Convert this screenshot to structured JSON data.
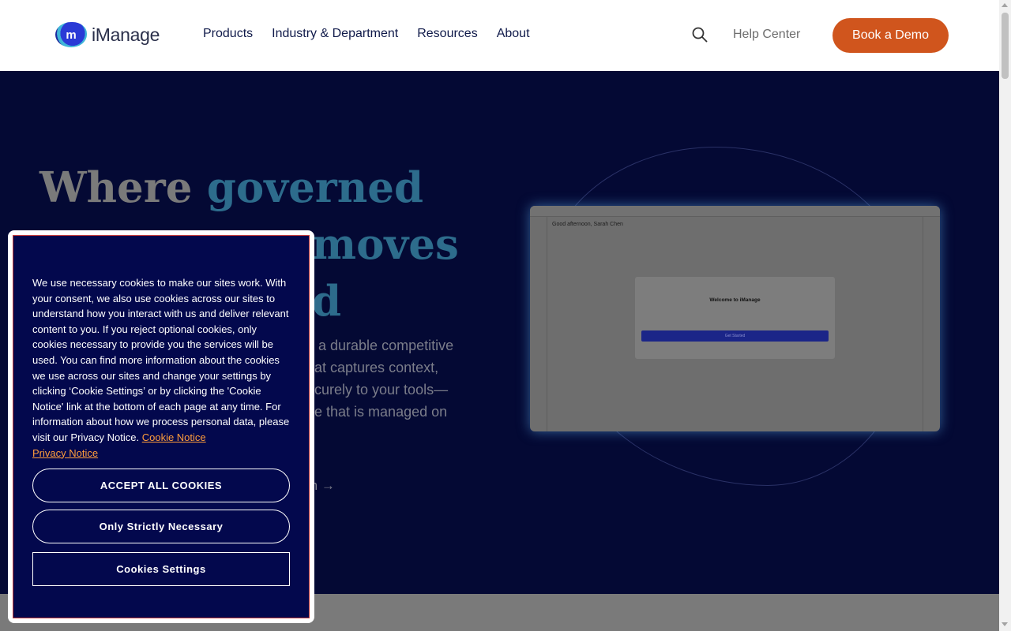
{
  "header": {
    "logo_text": "iManage",
    "logo_mark": "m",
    "nav": [
      "Products",
      "Industry & Department",
      "Resources",
      "About"
    ],
    "help_label": "Help Center",
    "cta_label": "Book a Demo",
    "cta_color": "#d0551d"
  },
  "hero": {
    "title_plain": "Where ",
    "title_accent": "governed",
    "title_line2_visible": "moves",
    "title_line3_visible": "d",
    "body_lines": [
      "o a durable competitive",
      "hat captures context,",
      "ecurely to your tools—",
      "ge that is managed on"
    ],
    "link_fragment": "m →",
    "background": "#040934",
    "app_preview": {
      "greeting": "Good afternoon, Sarah Chen",
      "modal_title": "Welcome to iManage",
      "modal_button": "Get Started"
    }
  },
  "cookie": {
    "text": "We use necessary cookies to make our sites work. With your consent, we also use cookies across our sites to understand how you interact with us and deliver relevant content to you. If you reject optional cookies, only cookies necessary to provide you the services will be used. You can find more information about the cookies we use across our sites and change your settings by clicking ‘Cookie Settings’ or by clicking the 'Cookie Notice' link at the bottom of each page at any time. For information about how we process personal data, please visit our Privacy Notice.",
    "cookie_notice_link": "Cookie Notice",
    "privacy_notice_link": "Privacy Notice",
    "accept_all": "ACCEPT ALL COOKIES",
    "strictly_necessary": "Only Strictly Necessary",
    "settings": "Cookies Settings",
    "background": "#03084d",
    "link_color": "#ff9d3b"
  },
  "icons": {
    "search": "search-icon",
    "arrow": "arrow-right-icon"
  }
}
